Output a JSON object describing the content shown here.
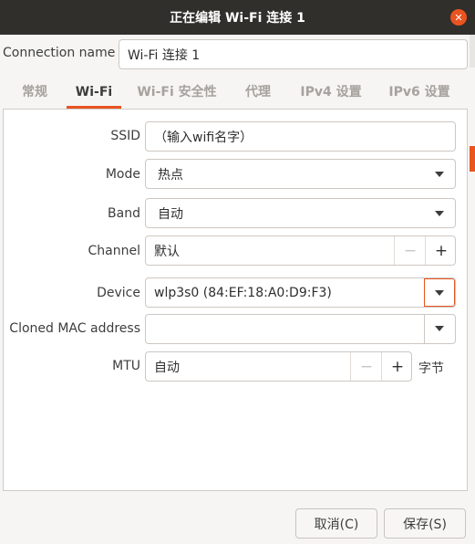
{
  "window": {
    "title": "正在编辑 Wi-Fi 连接 1"
  },
  "connection": {
    "label": "Connection name",
    "value": "Wi-Fi 连接 1"
  },
  "tabs": [
    {
      "label": "常规"
    },
    {
      "label": "Wi-Fi"
    },
    {
      "label": "Wi-Fi 安全性"
    },
    {
      "label": "代理"
    },
    {
      "label": "IPv4 设置"
    },
    {
      "label": "IPv6 设置"
    }
  ],
  "wifi": {
    "ssid": {
      "label": "SSID",
      "value": "（输入wifi名字）"
    },
    "mode": {
      "label": "Mode",
      "value": "热点"
    },
    "band": {
      "label": "Band",
      "value": "自动"
    },
    "channel": {
      "label": "Channel",
      "value": "默认",
      "minus": "−",
      "plus": "+"
    },
    "device": {
      "label": "Device",
      "value": "wlp3s0 (84:EF:18:A0:D9:F3)"
    },
    "cloned_mac": {
      "label": "Cloned MAC address",
      "value": ""
    },
    "mtu": {
      "label": "MTU",
      "value": "自动",
      "minus": "−",
      "plus": "+",
      "unit": "字节"
    }
  },
  "buttons": {
    "cancel": "取消(C)",
    "save": "保存(S)"
  },
  "colors": {
    "accent": "#e95420",
    "titlebar": "#302f2c"
  }
}
